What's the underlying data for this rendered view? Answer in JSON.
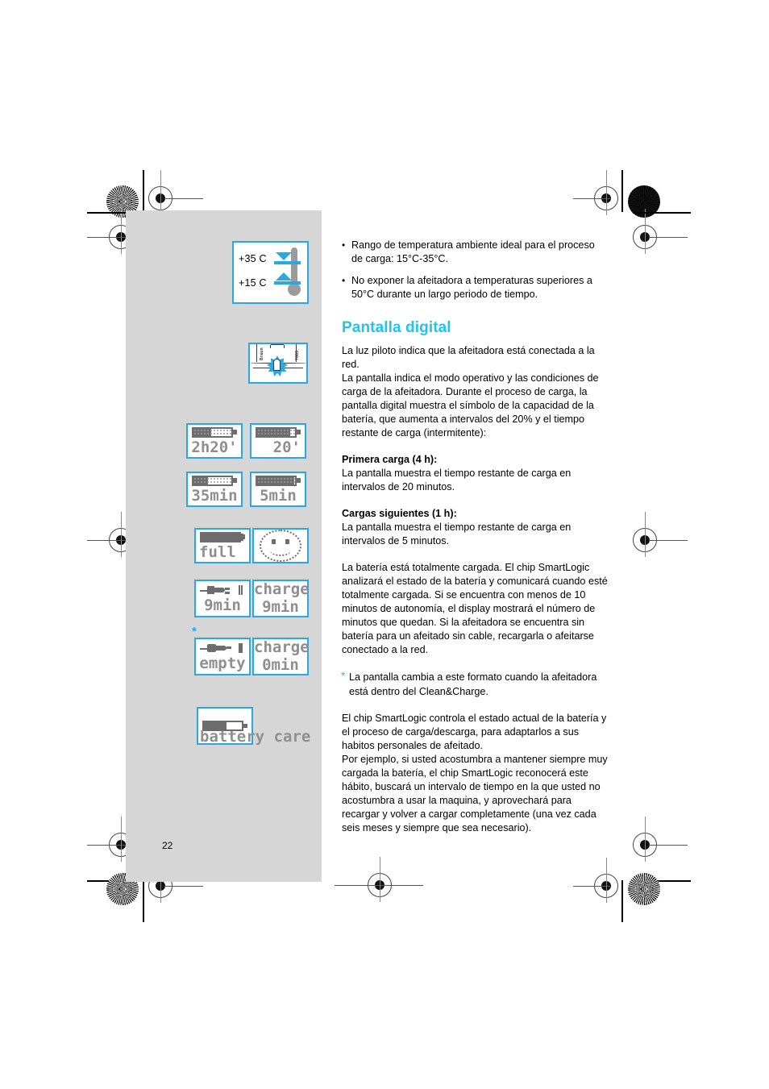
{
  "page": {
    "number": "22",
    "accent_color": "#22c3ee",
    "panel_color": "#d6d6d6",
    "lcd_color": "#8f8f8f"
  },
  "figures": {
    "thermometer": {
      "name": "temperature-range-figure",
      "upper_label": "+35 C",
      "lower_label": "+15 C"
    },
    "pilot_light": {
      "name": "pilot-light-figure",
      "brand_text": "Braun",
      "model_text": "7680"
    },
    "displays": [
      {
        "id": "d1",
        "battery_level": 45,
        "dotted": true,
        "glyph": "battery",
        "text": "2h20'"
      },
      {
        "id": "d2",
        "battery_level": 80,
        "dotted": true,
        "glyph": "battery",
        "text": "20'"
      },
      {
        "id": "d3",
        "battery_level": 35,
        "dotted": true,
        "glyph": "battery",
        "text": "35min"
      },
      {
        "id": "d4",
        "battery_level": 88,
        "dotted": true,
        "glyph": "battery",
        "text": "5min"
      },
      {
        "id": "d5",
        "battery_level": 100,
        "dotted": false,
        "glyph": "battery",
        "text": "full"
      },
      {
        "id": "d6",
        "glyph": "smiley",
        "text": ""
      },
      {
        "id": "d7",
        "glyph": "plug",
        "text": "9min"
      },
      {
        "id": "d8",
        "glyph": "none",
        "text": "charge\n9min"
      },
      {
        "id": "d9",
        "glyph": "plug-empty",
        "text": "empty"
      },
      {
        "id": "d10",
        "glyph": "none",
        "text": "charge\n0min"
      },
      {
        "id": "d11",
        "battery_level": 55,
        "dotted": false,
        "glyph": "battery",
        "text": "battery care"
      }
    ]
  },
  "text": {
    "bullets": [
      "Rango de temperatura ambiente ideal para el proceso de carga: 15°C-35°C.",
      "No exponer la afeitadora a temperaturas superiores a 50°C durante un largo periodo de tiempo."
    ],
    "section_title": "Pantalla digital",
    "intro": "La luz piloto indica que la afeitadora está conectada a la red.\nLa pantalla indica el modo operativo y las condiciones de carga de la afeitadora. Durante el proceso de carga, la pantalla digital muestra el símbolo de la capacidad de la batería, que aumenta a intervalos del 20% y el tiempo restante de carga (intermitente):",
    "first_charge_head": "Primera carga (4 h):",
    "first_charge_body": "La pantalla muestra el tiempo restante de carga en intervalos de 20 minutos.",
    "next_charge_head": "Cargas siguientes (1 h):",
    "next_charge_body": "La pantalla muestra el tiempo restante de carga en intervalos de 5 minutos.",
    "full_battery_para": "La batería está totalmente cargada. El chip SmartLogic analizará el estado de la batería y comunicará  cuando esté totalmente cargada. Si se encuentra con menos de 10 minutos de autonomía, el display mostrará el número de minutos que quedan. Si la afeitadora se encuentra sin batería para un afeitado sin cable, recargarla o afeitarse conectado a la red.",
    "star_symbol": "*",
    "clean_charge_para": "La pantalla cambia a este formato cuando la afeitadora está dentro del Clean&Charge.",
    "smartlogic_para": "El chip SmartLogic controla el estado actual de la batería y el proceso de carga/descarga, para adaptarlos a sus habitos personales de afeitado.\nPor ejemplo, si usted acostumbra a mantener siempre muy cargada la batería, el chip SmartLogic reconocerá este hábito, buscará un intervalo de tiempo en la que usted no acostumbra a usar la maquina, y aprovechará para recargar y volver a cargar completamente (una vez cada seis meses y siempre que sea necesario)."
  }
}
